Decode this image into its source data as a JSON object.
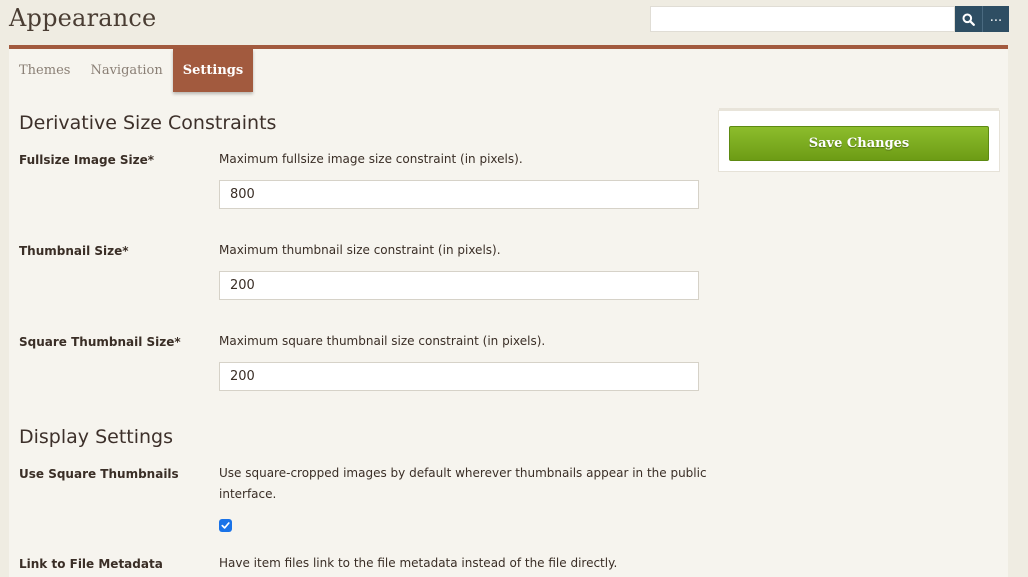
{
  "header": {
    "title": "Appearance",
    "search_value": "",
    "search_icon": "search-icon",
    "more_label": "..."
  },
  "tabs": [
    {
      "label": "Themes",
      "active": false
    },
    {
      "label": "Navigation",
      "active": false
    },
    {
      "label": "Settings",
      "active": true
    }
  ],
  "sections": {
    "derivative": {
      "heading": "Derivative Size Constraints",
      "fields": [
        {
          "label": "Fullsize Image Size*",
          "description": "Maximum fullsize image size constraint (in pixels).",
          "value": "800"
        },
        {
          "label": "Thumbnail Size*",
          "description": "Maximum thumbnail size constraint (in pixels).",
          "value": "200"
        },
        {
          "label": "Square Thumbnail Size*",
          "description": "Maximum square thumbnail size constraint (in pixels).",
          "value": "200"
        }
      ]
    },
    "display": {
      "heading": "Display Settings",
      "fields": [
        {
          "label": "Use Square Thumbnails",
          "description": "Use square-cropped images by default wherever thumbnails appear in the public interface.",
          "checked": true
        },
        {
          "label": "Link to File Metadata",
          "description": "Have item files link to the file metadata instead of the file directly."
        }
      ]
    }
  },
  "actions": {
    "save_label": "Save Changes"
  },
  "colors": {
    "accent": "#a25a3e",
    "save_green": "#7aab1f",
    "search_button": "#2e4e63"
  }
}
